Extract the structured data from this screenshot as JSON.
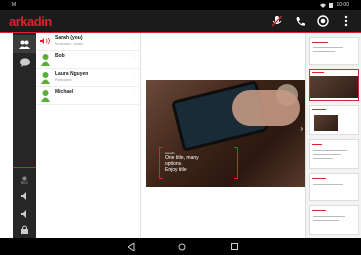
{
  "status_bar": {
    "left": "M",
    "time": "10:00"
  },
  "app": {
    "brand": "arkadin"
  },
  "participants": [
    {
      "name": "Sarah (you)",
      "sub": "Moderator · Audio",
      "speaking": true
    },
    {
      "name": "Bob",
      "sub": "",
      "speaking": false
    },
    {
      "name": "Laura Nguyen",
      "sub": "Participant",
      "speaking": false
    },
    {
      "name": "Michael",
      "sub": "",
      "speaking": false
    }
  ],
  "slide": {
    "small": "arkadin",
    "line1": "One title, many",
    "line2": "options.",
    "line3": "Enjoy title"
  },
  "rail": {
    "label": "REC"
  },
  "colors": {
    "accent": "#d8262f",
    "rail": "#262626",
    "bar": "#1b1b1b"
  },
  "icons": [
    "mute-icon",
    "phone-icon",
    "record-icon",
    "more-icon",
    "participants-icon",
    "chat-icon",
    "back-icon",
    "home-icon",
    "recents-icon",
    "lock-icon",
    "volume-icon"
  ]
}
